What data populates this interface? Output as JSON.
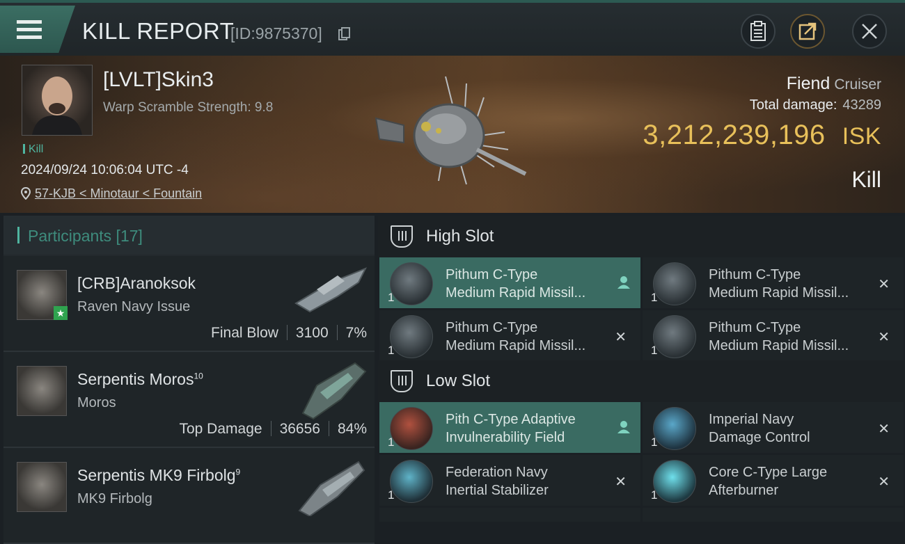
{
  "header": {
    "title": "KILL REPORT",
    "report_id": "[ID:9875370]",
    "icons": [
      "menu-icon",
      "copy-icon",
      "clipboard-icon",
      "share-icon",
      "close-icon"
    ]
  },
  "victim": {
    "name": "[LVLT]Skin3",
    "warp_scramble": "Warp Scramble Strength: 9.8",
    "tag": "Kill",
    "datetime": "2024/09/24 10:06:04 UTC -4",
    "location": "57-KJB < Minotaur < Fountain",
    "ship_name": "Fiend",
    "ship_class": "Cruiser",
    "total_damage_label": "Total damage:",
    "total_damage": "43289",
    "isk_value": "3,212,239,196",
    "isk_unit": "ISK",
    "result": "Kill"
  },
  "participants": {
    "label": "Participants [17]",
    "rows": [
      {
        "name": "[CRB]Aranoksok",
        "sup": "",
        "ship": "Raven Navy Issue",
        "stat_label": "Final Blow",
        "damage": "3100",
        "percent": "7%"
      },
      {
        "name": "Serpentis Moros",
        "sup": "10",
        "ship": "Moros",
        "stat_label": "Top Damage",
        "damage": "36656",
        "percent": "84%"
      },
      {
        "name": "Serpentis MK9 Firbolg",
        "sup": "9",
        "ship": "MK9 Firbolg",
        "stat_label": "",
        "damage": "",
        "percent": ""
      }
    ]
  },
  "fitting": {
    "high_slot_label": "High Slot",
    "low_slot_label": "Low Slot",
    "high_slot": [
      {
        "name": "Pithum C-Type\nMedium Rapid Missil...",
        "qty": "1",
        "state": "selected"
      },
      {
        "name": "Pithum C-Type\nMedium Rapid Missil...",
        "qty": "1",
        "state": "destroyed"
      },
      {
        "name": "Pithum C-Type\nMedium Rapid Missil...",
        "qty": "1",
        "state": "destroyed"
      },
      {
        "name": "Pithum C-Type\nMedium Rapid Missil...",
        "qty": "1",
        "state": "destroyed"
      }
    ],
    "low_slot": [
      {
        "name": "Pith C-Type Adaptive\nInvulnerability Field",
        "qty": "1",
        "state": "selected"
      },
      {
        "name": "Imperial Navy\nDamage Control",
        "qty": "1",
        "state": "destroyed"
      },
      {
        "name": "Federation Navy\nInertial Stabilizer",
        "qty": "1",
        "state": "destroyed"
      },
      {
        "name": "Core C-Type Large\nAfterburner",
        "qty": "1",
        "state": "destroyed"
      }
    ],
    "destroyed_mark": "✕"
  }
}
